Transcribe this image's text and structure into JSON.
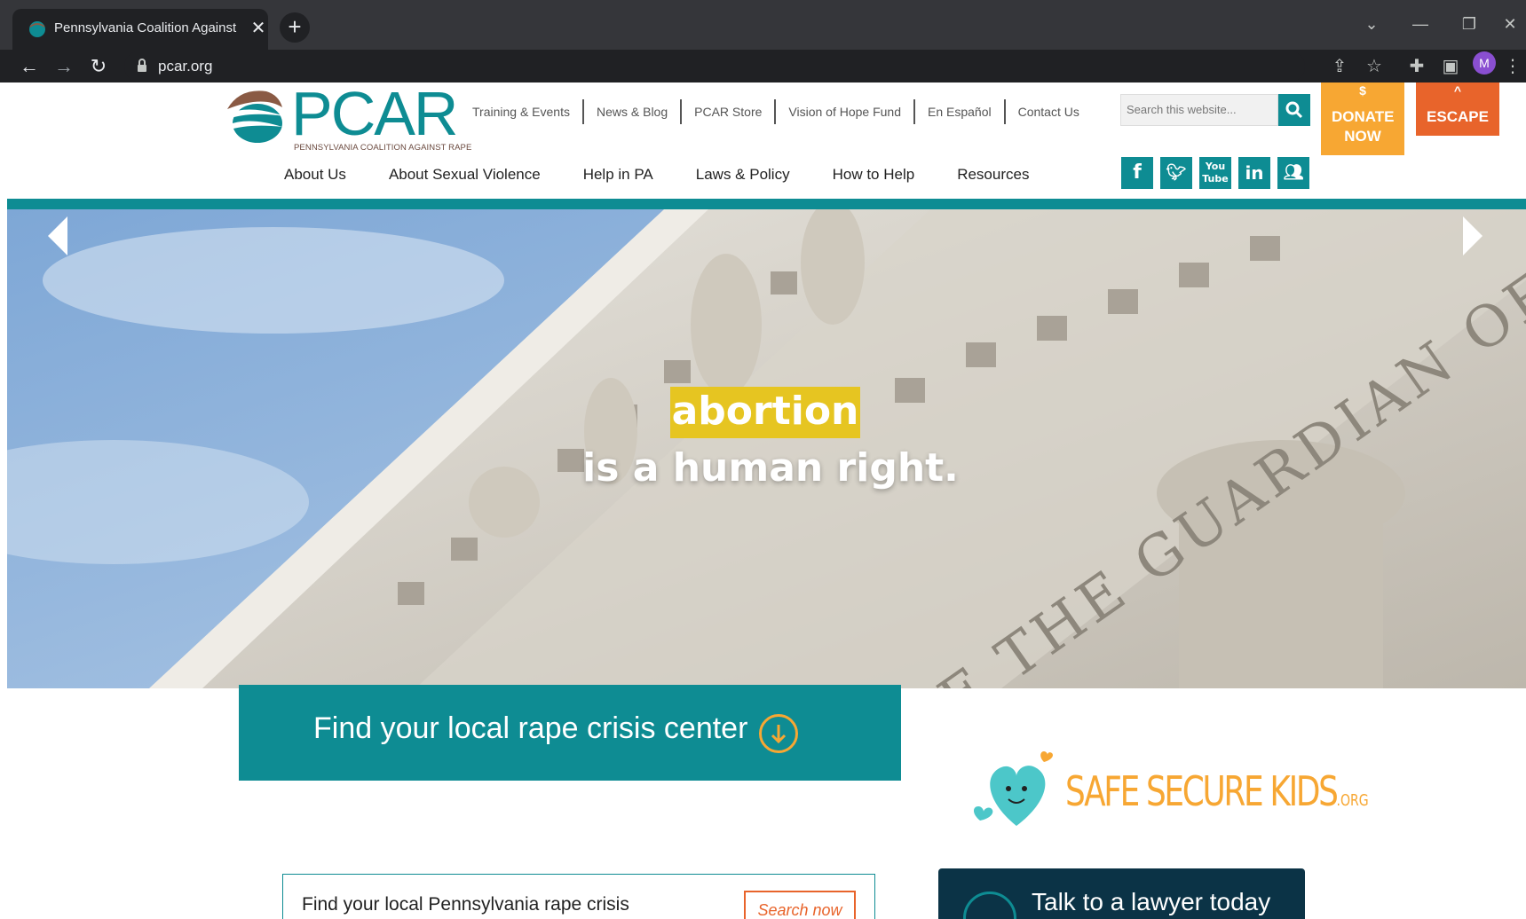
{
  "browser": {
    "tab_title": "Pennsylvania Coalition Against Rape",
    "url": "pcar.org",
    "avatar_initial": "M",
    "tab_close": "✕",
    "new_tab": "+"
  },
  "header": {
    "logo_text": "PCAR",
    "logo_tagline": "PENNSYLVANIA COALITION AGAINST RAPE",
    "util_nav": [
      "Training & Events",
      "News & Blog",
      "PCAR Store",
      "Vision of Hope Fund",
      "En Español",
      "Contact Us"
    ],
    "search_placeholder": "Search this website...",
    "donate_symbol": "$",
    "donate_label": "DONATE NOW",
    "escape_symbol": "^",
    "escape_label": "ESCAPE",
    "main_nav": [
      "About Us",
      "About Sexual Violence",
      "Help in PA",
      "Laws & Policy",
      "How to Help",
      "Resources"
    ],
    "social": [
      "facebook-icon",
      "twitter-icon",
      "youtube-icon",
      "linkedin-icon",
      "community-icon"
    ]
  },
  "hero": {
    "line1": "abortion",
    "line2": "is a human right.",
    "engraving": "JUSTICE THE GUARDIAN OF"
  },
  "find_center": {
    "heading": "Find your local rape crisis center",
    "body_text": "Find your local Pennsylvania rape crisis",
    "button_label": "Search now"
  },
  "safe_secure_kids": {
    "name": "SAFE SECURE KIDS",
    "suffix": ".ORG"
  },
  "lawyer": {
    "label": "Talk to a lawyer today"
  },
  "colors": {
    "teal": "#0e8c93",
    "orange": "#f7a733",
    "escape": "#e8642b",
    "hero_highlight": "#e6c521",
    "navy": "#0b3346"
  }
}
